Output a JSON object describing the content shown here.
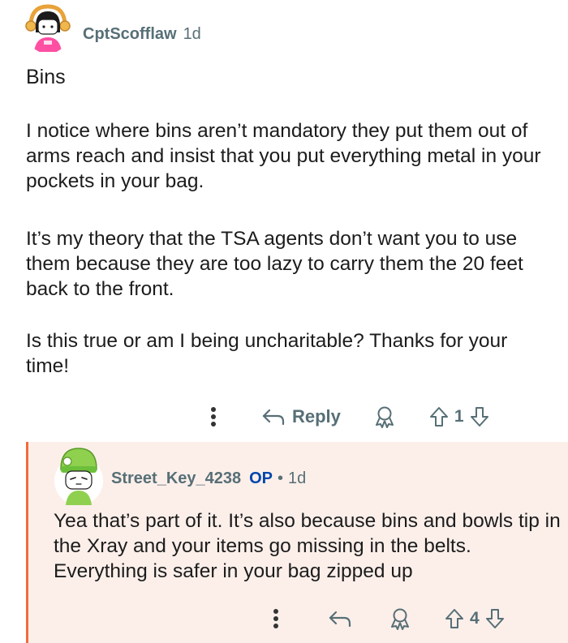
{
  "top_comment": {
    "author": "CptScofflaw",
    "time": "1d",
    "title": "Bins",
    "paragraphs": [
      "I notice where bins aren’t mandatory they put them out of arms reach and insist that you put everything metal in your pockets in your bag.",
      "It’s my theory that the TSA agents don’t want you to use them because they are too lazy to carry them the 20 feet back to the front.",
      "Is this true or am I being uncharitable? Thanks for your time!"
    ],
    "actions": {
      "more_icon": "more-dots-icon",
      "reply_label": "Reply",
      "award_icon": "award-icon",
      "vote_count": "1"
    }
  },
  "reply_comment": {
    "author": "Street_Key_4238",
    "op_badge": "OP",
    "separator": "•",
    "time": "1d",
    "body": "Yea that’s part of it. It’s also because bins and bowls tip in the Xray and your items go missing in the belts. Everything is safer in your bag zipped up",
    "actions": {
      "vote_count": "4"
    }
  },
  "colors": {
    "meta_text": "#576f76",
    "op_badge": "#0045ac",
    "reply_bg": "#fcefea",
    "reply_border": "#f26b3c"
  }
}
